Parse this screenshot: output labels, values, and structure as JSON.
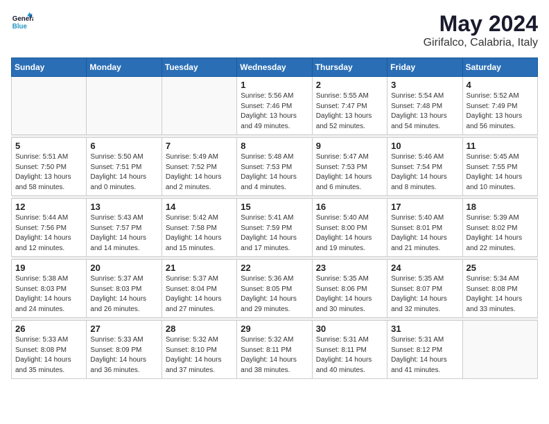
{
  "header": {
    "logo_general": "General",
    "logo_blue": "Blue",
    "month_title": "May 2024",
    "location": "Girifalco, Calabria, Italy"
  },
  "weekdays": [
    "Sunday",
    "Monday",
    "Tuesday",
    "Wednesday",
    "Thursday",
    "Friday",
    "Saturday"
  ],
  "weeks": [
    [
      {
        "day": "",
        "info": ""
      },
      {
        "day": "",
        "info": ""
      },
      {
        "day": "",
        "info": ""
      },
      {
        "day": "1",
        "info": "Sunrise: 5:56 AM\nSunset: 7:46 PM\nDaylight: 13 hours\nand 49 minutes."
      },
      {
        "day": "2",
        "info": "Sunrise: 5:55 AM\nSunset: 7:47 PM\nDaylight: 13 hours\nand 52 minutes."
      },
      {
        "day": "3",
        "info": "Sunrise: 5:54 AM\nSunset: 7:48 PM\nDaylight: 13 hours\nand 54 minutes."
      },
      {
        "day": "4",
        "info": "Sunrise: 5:52 AM\nSunset: 7:49 PM\nDaylight: 13 hours\nand 56 minutes."
      }
    ],
    [
      {
        "day": "5",
        "info": "Sunrise: 5:51 AM\nSunset: 7:50 PM\nDaylight: 13 hours\nand 58 minutes."
      },
      {
        "day": "6",
        "info": "Sunrise: 5:50 AM\nSunset: 7:51 PM\nDaylight: 14 hours\nand 0 minutes."
      },
      {
        "day": "7",
        "info": "Sunrise: 5:49 AM\nSunset: 7:52 PM\nDaylight: 14 hours\nand 2 minutes."
      },
      {
        "day": "8",
        "info": "Sunrise: 5:48 AM\nSunset: 7:53 PM\nDaylight: 14 hours\nand 4 minutes."
      },
      {
        "day": "9",
        "info": "Sunrise: 5:47 AM\nSunset: 7:53 PM\nDaylight: 14 hours\nand 6 minutes."
      },
      {
        "day": "10",
        "info": "Sunrise: 5:46 AM\nSunset: 7:54 PM\nDaylight: 14 hours\nand 8 minutes."
      },
      {
        "day": "11",
        "info": "Sunrise: 5:45 AM\nSunset: 7:55 PM\nDaylight: 14 hours\nand 10 minutes."
      }
    ],
    [
      {
        "day": "12",
        "info": "Sunrise: 5:44 AM\nSunset: 7:56 PM\nDaylight: 14 hours\nand 12 minutes."
      },
      {
        "day": "13",
        "info": "Sunrise: 5:43 AM\nSunset: 7:57 PM\nDaylight: 14 hours\nand 14 minutes."
      },
      {
        "day": "14",
        "info": "Sunrise: 5:42 AM\nSunset: 7:58 PM\nDaylight: 14 hours\nand 15 minutes."
      },
      {
        "day": "15",
        "info": "Sunrise: 5:41 AM\nSunset: 7:59 PM\nDaylight: 14 hours\nand 17 minutes."
      },
      {
        "day": "16",
        "info": "Sunrise: 5:40 AM\nSunset: 8:00 PM\nDaylight: 14 hours\nand 19 minutes."
      },
      {
        "day": "17",
        "info": "Sunrise: 5:40 AM\nSunset: 8:01 PM\nDaylight: 14 hours\nand 21 minutes."
      },
      {
        "day": "18",
        "info": "Sunrise: 5:39 AM\nSunset: 8:02 PM\nDaylight: 14 hours\nand 22 minutes."
      }
    ],
    [
      {
        "day": "19",
        "info": "Sunrise: 5:38 AM\nSunset: 8:03 PM\nDaylight: 14 hours\nand 24 minutes."
      },
      {
        "day": "20",
        "info": "Sunrise: 5:37 AM\nSunset: 8:03 PM\nDaylight: 14 hours\nand 26 minutes."
      },
      {
        "day": "21",
        "info": "Sunrise: 5:37 AM\nSunset: 8:04 PM\nDaylight: 14 hours\nand 27 minutes."
      },
      {
        "day": "22",
        "info": "Sunrise: 5:36 AM\nSunset: 8:05 PM\nDaylight: 14 hours\nand 29 minutes."
      },
      {
        "day": "23",
        "info": "Sunrise: 5:35 AM\nSunset: 8:06 PM\nDaylight: 14 hours\nand 30 minutes."
      },
      {
        "day": "24",
        "info": "Sunrise: 5:35 AM\nSunset: 8:07 PM\nDaylight: 14 hours\nand 32 minutes."
      },
      {
        "day": "25",
        "info": "Sunrise: 5:34 AM\nSunset: 8:08 PM\nDaylight: 14 hours\nand 33 minutes."
      }
    ],
    [
      {
        "day": "26",
        "info": "Sunrise: 5:33 AM\nSunset: 8:08 PM\nDaylight: 14 hours\nand 35 minutes."
      },
      {
        "day": "27",
        "info": "Sunrise: 5:33 AM\nSunset: 8:09 PM\nDaylight: 14 hours\nand 36 minutes."
      },
      {
        "day": "28",
        "info": "Sunrise: 5:32 AM\nSunset: 8:10 PM\nDaylight: 14 hours\nand 37 minutes."
      },
      {
        "day": "29",
        "info": "Sunrise: 5:32 AM\nSunset: 8:11 PM\nDaylight: 14 hours\nand 38 minutes."
      },
      {
        "day": "30",
        "info": "Sunrise: 5:31 AM\nSunset: 8:11 PM\nDaylight: 14 hours\nand 40 minutes."
      },
      {
        "day": "31",
        "info": "Sunrise: 5:31 AM\nSunset: 8:12 PM\nDaylight: 14 hours\nand 41 minutes."
      },
      {
        "day": "",
        "info": ""
      }
    ]
  ]
}
